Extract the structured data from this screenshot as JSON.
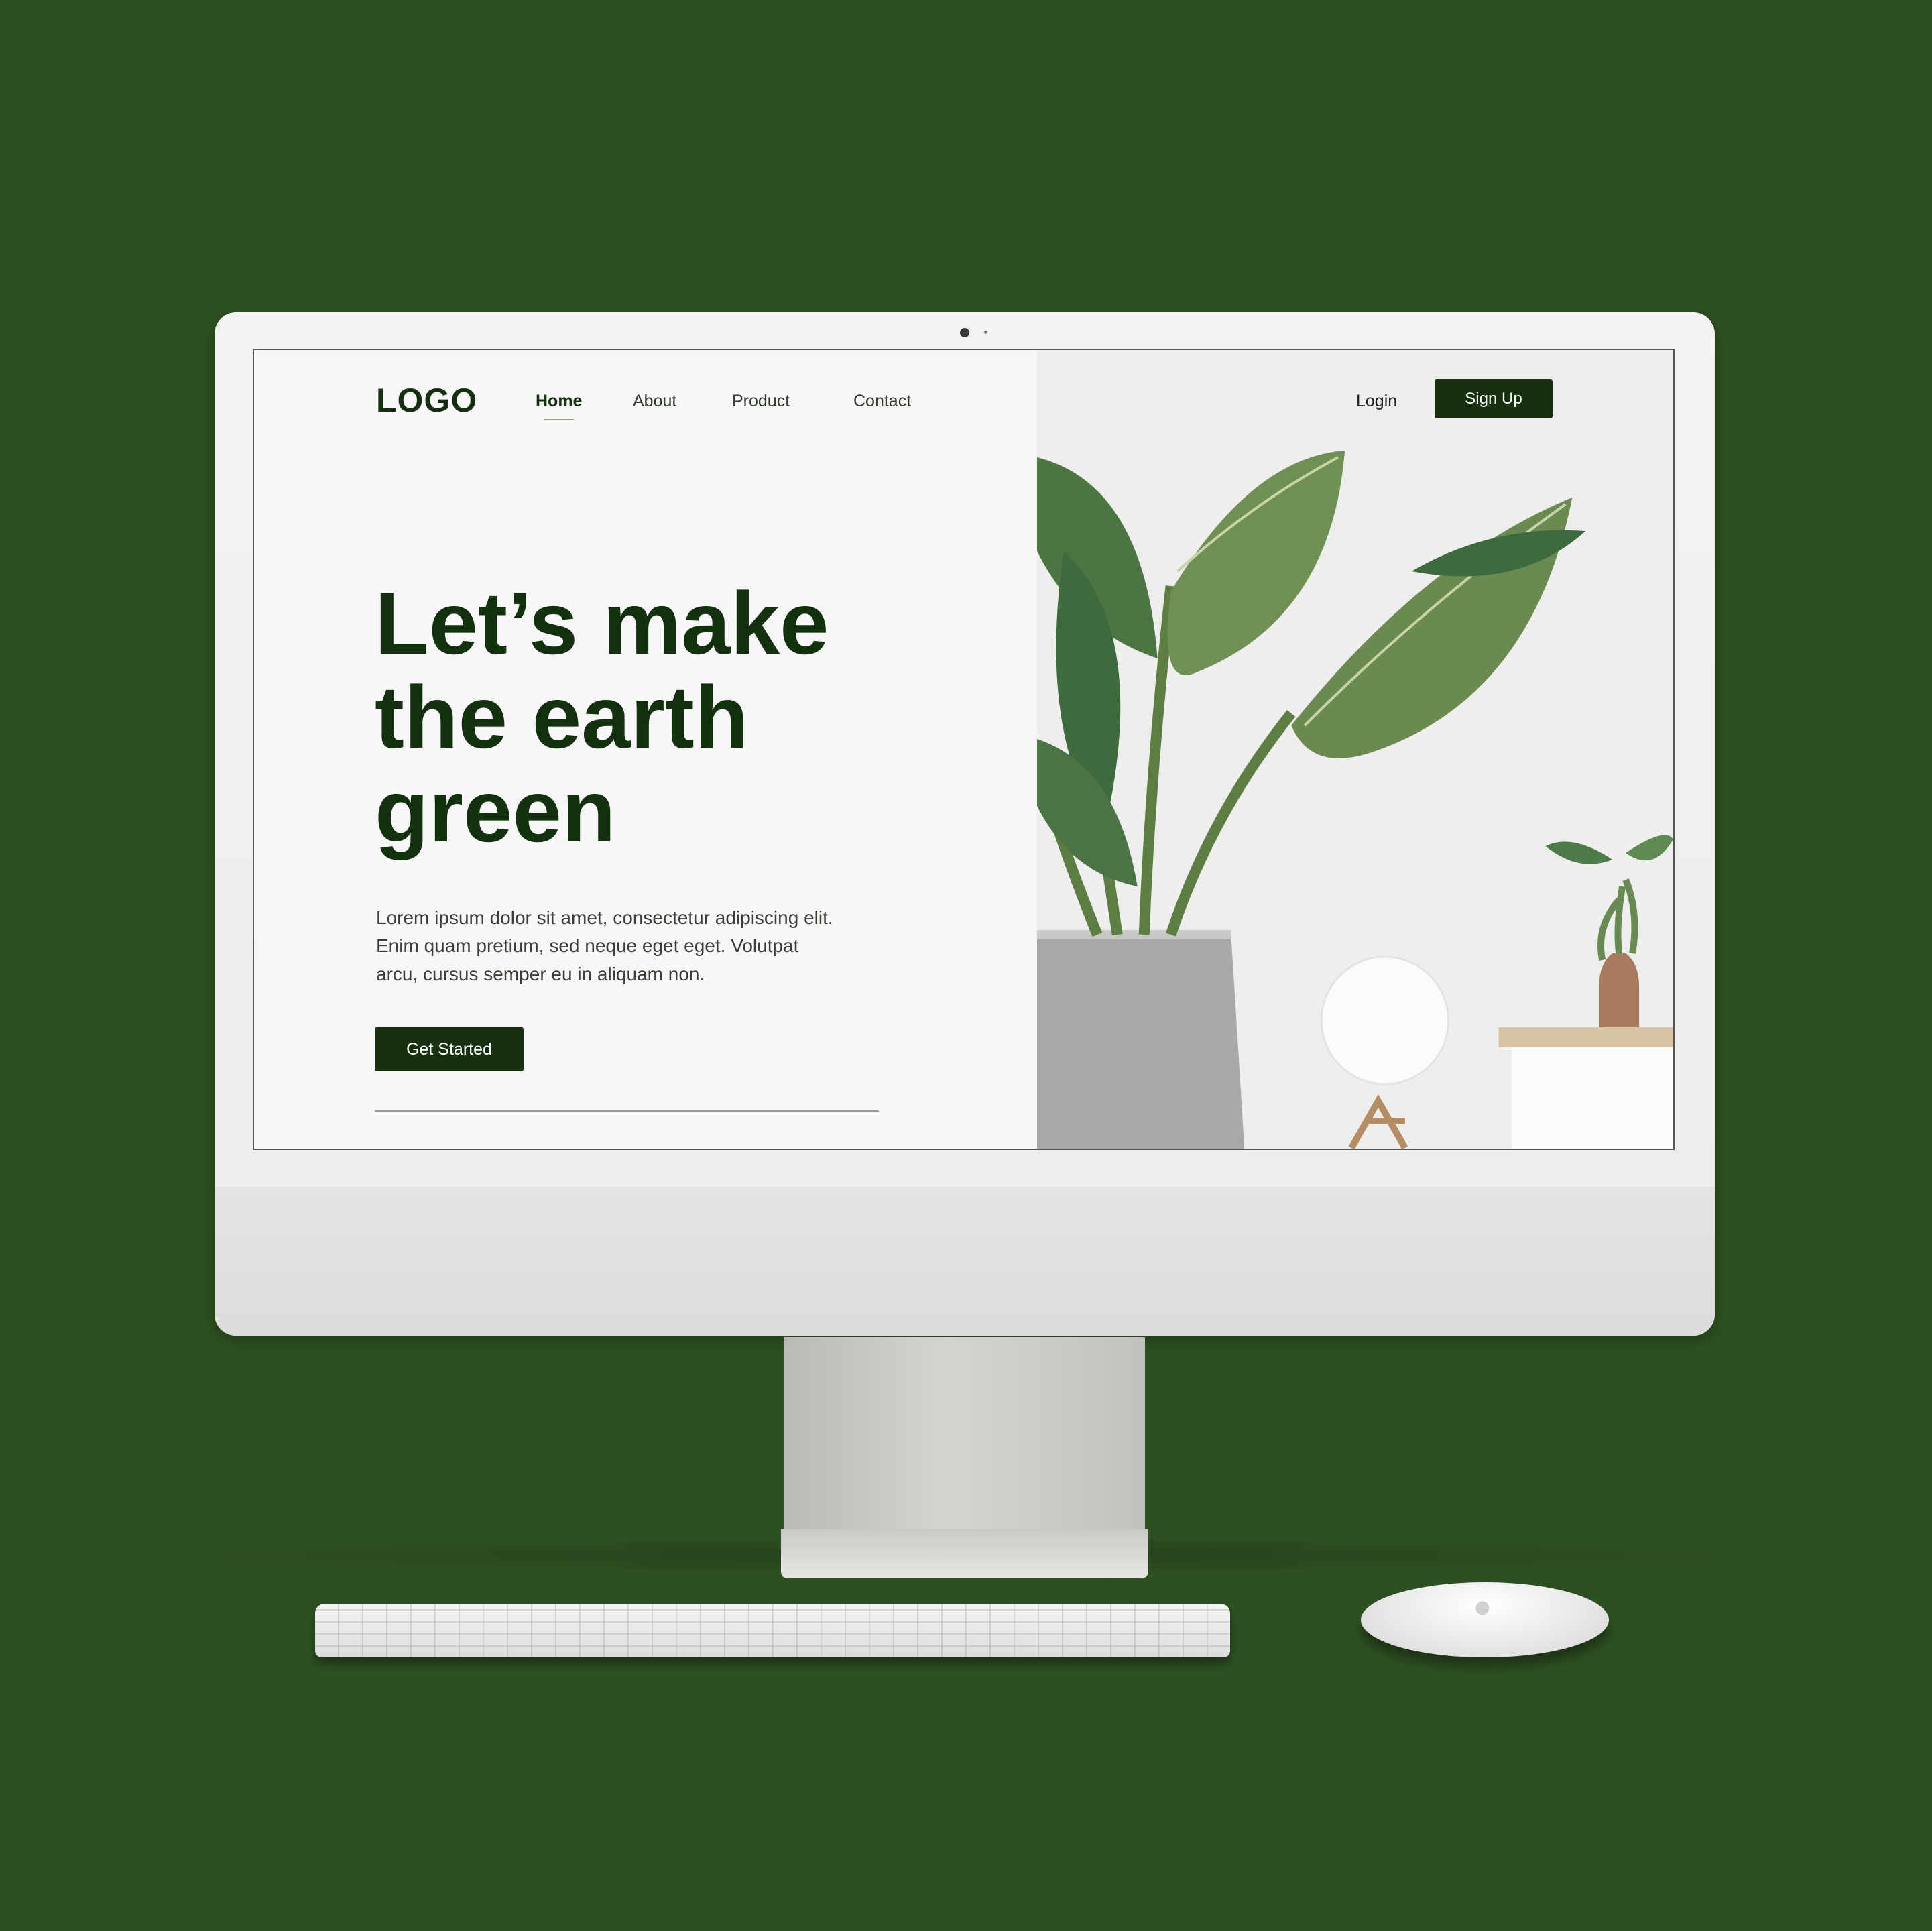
{
  "background_color": "#2d5022",
  "accent_color": "#173010",
  "site": {
    "logo": "LOGO",
    "nav": [
      "Home",
      "About",
      "Product",
      "Contact"
    ],
    "active_nav": "Home",
    "login": "Login",
    "signup": "Sign Up",
    "hero_title_lines": [
      "Let’s make",
      "the earth",
      "green"
    ],
    "hero_text_lines": [
      "Lorem ipsum dolor sit amet, consectetur adipiscing elit.",
      "Enim quam pretium, sed neque eget eget. Volutpat",
      "arcu, cursus semper eu in aliquam non."
    ],
    "cta": "Get Started",
    "hero_image": "potted-plants-photo"
  },
  "devices": {
    "monitor": "desktop-monitor",
    "keyboard": "keyboard",
    "mouse": "mouse"
  }
}
